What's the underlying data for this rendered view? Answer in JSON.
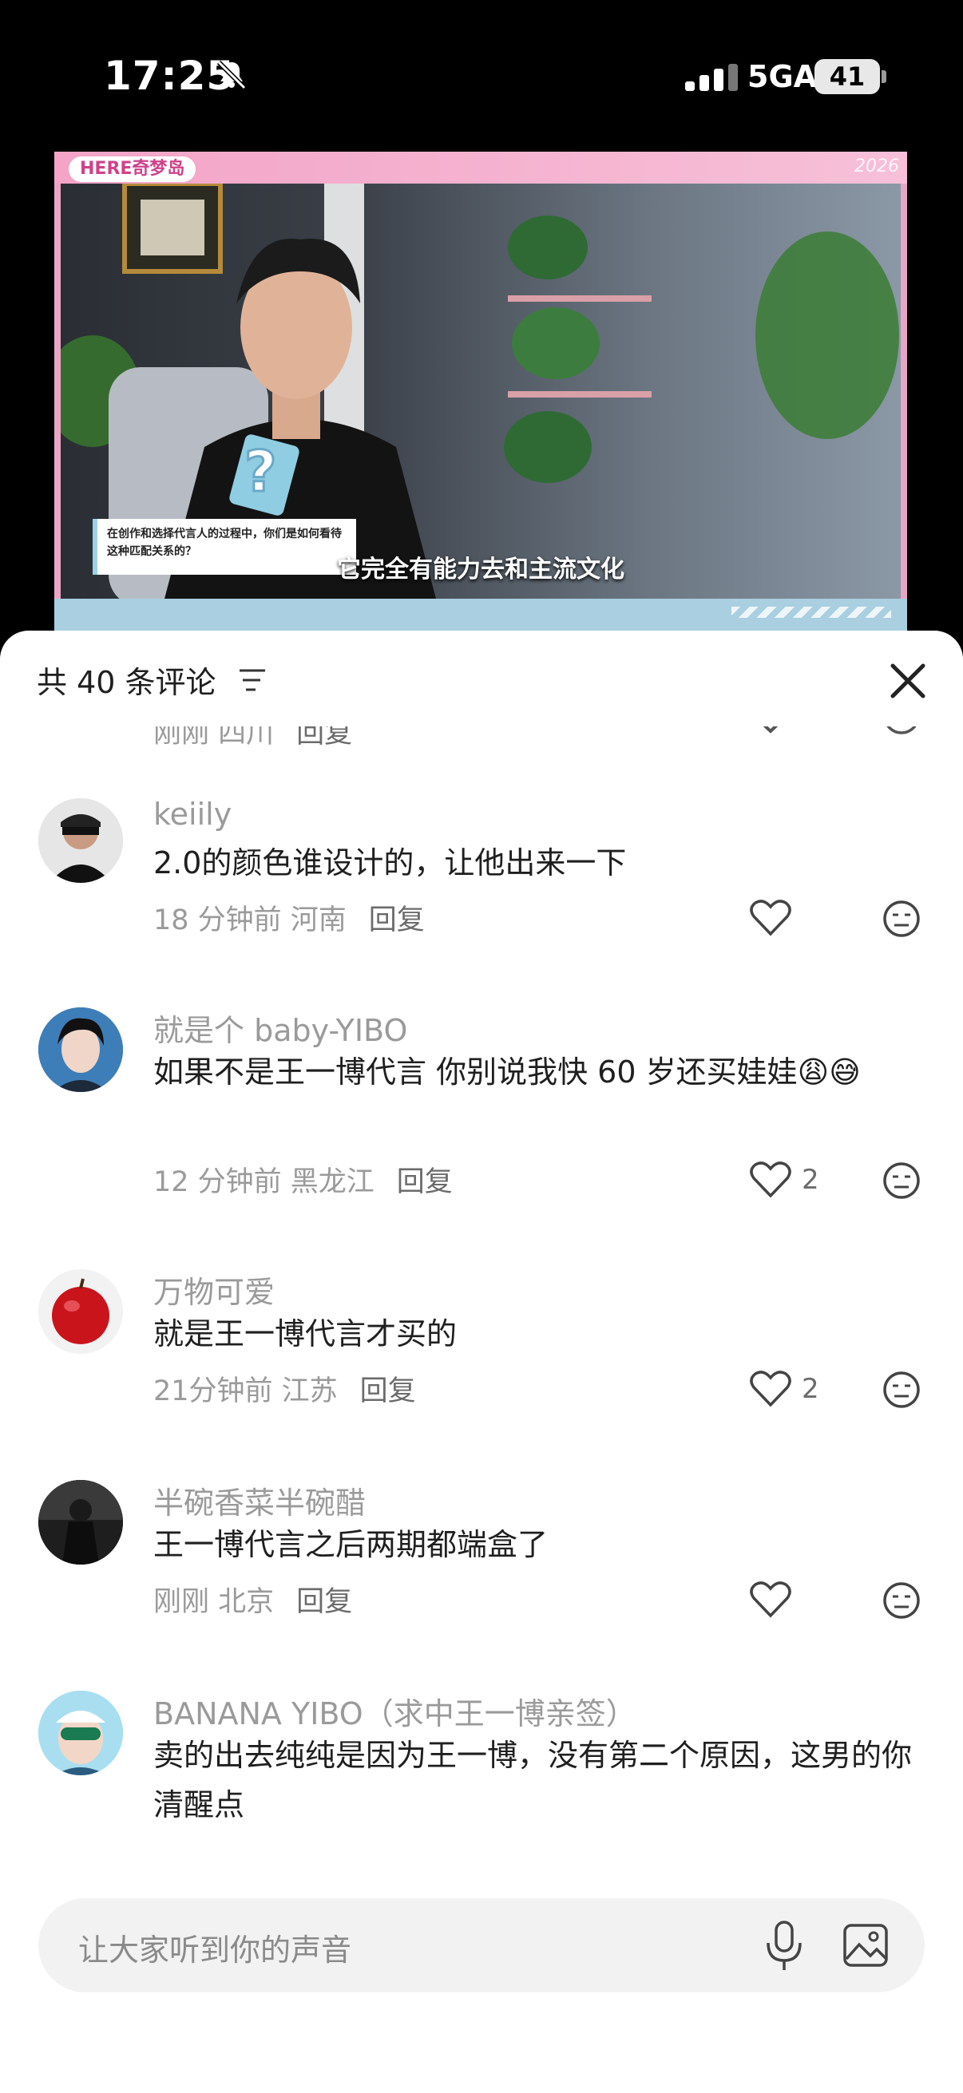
{
  "status_bar": {
    "time": "17:25",
    "network": "5GA",
    "battery": "41",
    "icons": [
      "bell-muted-icon",
      "signal-icon",
      "battery-icon"
    ]
  },
  "video": {
    "logo": "HERE奇梦岛",
    "year": "2026",
    "question": "在创作和选择代言人的过程中，你们是如何看待这种匹配关系的？",
    "subtitle": "它完全有能力去和主流文化"
  },
  "sheet": {
    "title": "共 40 条评论",
    "icons": [
      "filter-icon",
      "close-icon"
    ]
  },
  "partial_top": {
    "meta": "刚刚 四川",
    "reply": "回复"
  },
  "comments": [
    {
      "username": "keiily",
      "text": "2.0的颜色谁设计的，让他出来一下",
      "meta": "18 分钟前 河南",
      "reply": "回复",
      "likes": ""
    },
    {
      "username": "就是个 baby-YIBO",
      "text": "如果不是王一博代言    你别说我快 60 岁还买娃娃😩😅",
      "meta": "12 分钟前 黑龙江",
      "reply": "回复",
      "likes": "2"
    },
    {
      "username": "万物可爱",
      "text": "就是王一博代言才买的",
      "meta": "21分钟前 江苏",
      "reply": "回复",
      "likes": "2"
    },
    {
      "username": "半碗香菜半碗醋",
      "text": "王一博代言之后两期都端盒了",
      "meta": "刚刚 北京",
      "reply": "回复",
      "likes": ""
    },
    {
      "username": "BANANA YIBO（求中王一博亲签）",
      "text": "卖的出去纯纯是因为王一博，没有第二个原因，这男的你清醒点",
      "meta": "",
      "reply": "",
      "likes": ""
    }
  ],
  "input": {
    "placeholder": "让大家听到你的声音",
    "icons": [
      "microphone-icon",
      "image-icon"
    ]
  },
  "colors": {
    "accent_pink": "#e8a6c4",
    "meta_gray": "#9a9a9a"
  }
}
